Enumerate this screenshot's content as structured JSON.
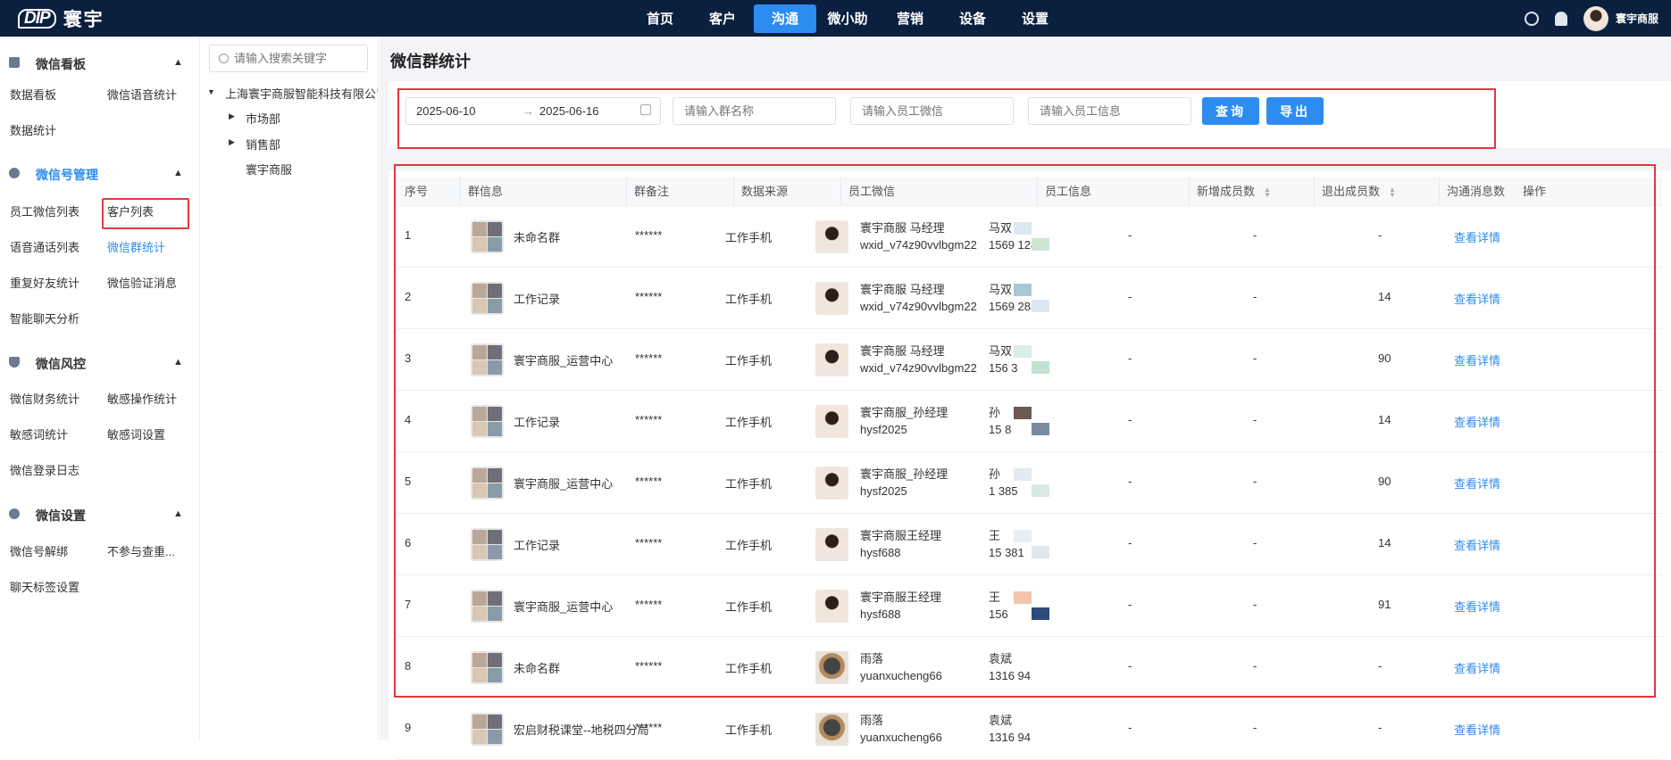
{
  "app": {
    "brand_mark": "DIP",
    "brand_name": "寰宇"
  },
  "nav": {
    "items": [
      "首页",
      "客户",
      "沟通",
      "微小助",
      "营销",
      "设备",
      "设置"
    ],
    "active_index": 2
  },
  "user": {
    "name": "寰宇商服"
  },
  "sidebar": {
    "sections": [
      {
        "title": "微信看板",
        "links": [
          "数据看板",
          "微信语音统计",
          "数据统计"
        ]
      },
      {
        "title": "微信号管理",
        "links": [
          "员工微信列表",
          "客户列表",
          "语音通话列表",
          "微信群统计",
          "重复好友统计",
          "微信验证消息",
          "智能聊天分析"
        ]
      },
      {
        "title": "微信风控",
        "links": [
          "微信财务统计",
          "敏感操作统计",
          "敏感词统计",
          "敏感词设置",
          "微信登录日志"
        ]
      },
      {
        "title": "微信设置",
        "links": [
          "微信号解绑",
          "不参与查重...",
          "聊天标签设置"
        ]
      }
    ],
    "active_link": "微信群统计"
  },
  "tree": {
    "search_placeholder": "请输入搜索关键字",
    "root": "上海寰宇商服智能科技有限公司",
    "children": [
      "市场部",
      "销售部",
      "寰宇商服"
    ]
  },
  "page": {
    "title": "微信群统计"
  },
  "filter": {
    "date_start": "2025-06-10",
    "date_arrow": "→",
    "date_end": "2025-06-16",
    "group_name_placeholder": "请输入群名称",
    "staff_wechat_placeholder": "请输入员工微信",
    "staff_info_placeholder": "请输入员工信息",
    "query_label": "查询",
    "export_label": "导出"
  },
  "table": {
    "columns": [
      "序号",
      "群信息",
      "群备注",
      "数据来源",
      "员工微信",
      "员工信息",
      "新增成员数",
      "退出成员数",
      "沟通消息数",
      "操作"
    ],
    "rows": [
      {
        "no": "1",
        "group": "未命名群",
        "remark": "******",
        "source": "工作手机",
        "staff_name": "寰宇商服 马经理",
        "staff_wxid": "wxid_v74z90vvlbgm22",
        "info1": "马双",
        "info2": "1569    1283",
        "added": "-",
        "left": "-",
        "messages": "-",
        "action": "查看详情"
      },
      {
        "no": "2",
        "group": "工作记录",
        "remark": "******",
        "source": "工作手机",
        "staff_name": "寰宇商服 马经理",
        "staff_wxid": "wxid_v74z90vvlbgm22",
        "info1": "马双",
        "info2": "1569    283",
        "added": "-",
        "left": "-",
        "messages": "14",
        "action": "查看详情"
      },
      {
        "no": "3",
        "group": "寰宇商服_运营中心",
        "remark": "******",
        "source": "工作手机",
        "staff_name": "寰宇商服 马经理",
        "staff_wxid": "wxid_v74z90vvlbgm22",
        "info1": "马双",
        "info2": "156      3",
        "added": "-",
        "left": "-",
        "messages": "90",
        "action": "查看详情"
      },
      {
        "no": "4",
        "group": "工作记录",
        "remark": "******",
        "source": "工作手机",
        "staff_name": "寰宇商服_孙经理",
        "staff_wxid": "hysf2025",
        "info1": "孙",
        "info2": "15    8",
        "added": "-",
        "left": "-",
        "messages": "14",
        "action": "查看详情"
      },
      {
        "no": "5",
        "group": "寰宇商服_运营中心",
        "remark": "******",
        "source": "工作手机",
        "staff_name": "寰宇商服_孙经理",
        "staff_wxid": "hysf2025",
        "info1": "孙",
        "info2": "1    385",
        "added": "-",
        "left": "-",
        "messages": "90",
        "action": "查看详情"
      },
      {
        "no": "6",
        "group": "工作记录",
        "remark": "******",
        "source": "工作手机",
        "staff_name": "寰宇商服王经理",
        "staff_wxid": "hysf688",
        "info1": "王",
        "info2": "15    381",
        "added": "-",
        "left": "-",
        "messages": "14",
        "action": "查看详情"
      },
      {
        "no": "7",
        "group": "寰宇商服_运营中心",
        "remark": "******",
        "source": "工作手机",
        "staff_name": "寰宇商服王经理",
        "staff_wxid": "hysf688",
        "info1": "王",
        "info2": "156",
        "added": "-",
        "left": "-",
        "messages": "91",
        "action": "查看详情"
      },
      {
        "no": "8",
        "group": "未命名群",
        "remark": "******",
        "source": "工作手机",
        "staff_name": "雨落",
        "staff_wxid": "yuanxucheng66",
        "info1": "袁斌",
        "info2": "1316      94",
        "added": "-",
        "left": "-",
        "messages": "-",
        "action": "查看详情"
      },
      {
        "no": "9",
        "group": "宏启财税课堂--地税四分局",
        "remark": "******",
        "source": "工作手机",
        "staff_name": "雨落",
        "staff_wxid": "yuanxucheng66",
        "info1": "袁斌",
        "info2": "1316    94",
        "added": "-",
        "left": "-",
        "messages": "-",
        "action": "查看详情"
      }
    ]
  },
  "colors": {
    "topbar": "#0b1f3f",
    "accent": "#2d8cf0",
    "highlight_box": "#e0383e"
  }
}
